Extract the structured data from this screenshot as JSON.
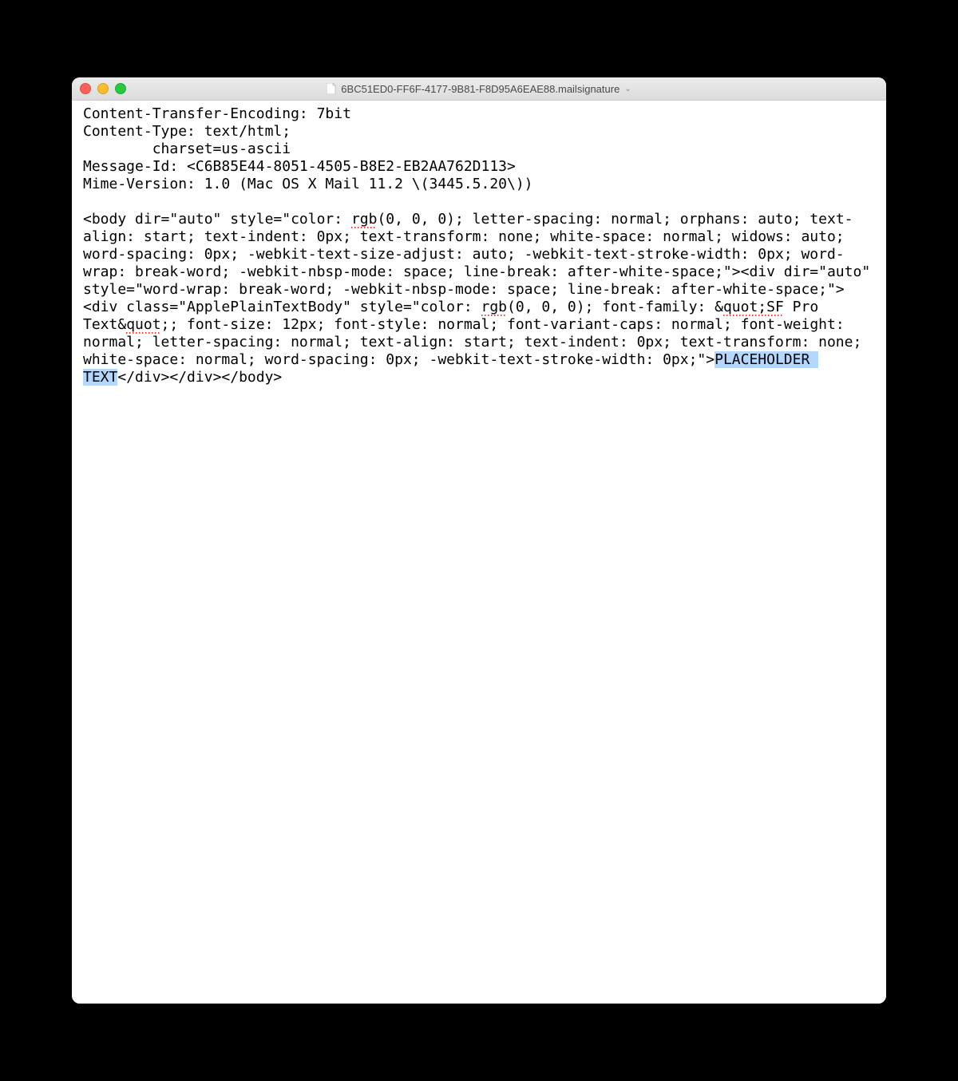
{
  "window": {
    "filename": "6BC51ED0-FF6F-4177-9B81-F8D95A6EAE88.mailsignature"
  },
  "editor": {
    "headers": {
      "l1": "Content-Transfer-Encoding: 7bit",
      "l2": "Content-Type: text/html;",
      "l3": "        charset=us-ascii",
      "l4": "Message-Id: <C6B85E44-8051-4505-B8E2-EB2AA762D113>",
      "l5": "Mime-Version: 1.0 (Mac OS X Mail 11.2 \\(3445.5.20\\))"
    },
    "body": {
      "p1a": "<body dir=\"auto\" style=\"color: ",
      "p1b_sq": "rgb",
      "p1c": "(0, 0, 0); letter-spacing: normal; orphans: auto; text-align: start; text-indent: 0px; text-transform: none; white-space: normal; widows: auto; word-spacing: 0px; -webkit-text-size-adjust: auto; -webkit-text-stroke-width: 0px; word-wrap: break-word; -webkit-nbsp-mode: space; line-break: after-white-space;\"><div dir=\"auto\" style=\"word-wrap: break-word; -webkit-nbsp-mode: space; line-break: after-white-space;\"><div class=\"ApplePlainTextBody\" style=\"color: ",
      "p1d_sq": "rgb",
      "p1e": "(0, 0, 0); font-family: &",
      "p1f_sq": "quot;SF",
      "p1g": " Pro Text&",
      "p1h_sq": "quot",
      "p1i": ";; font-size: 12px; font-style: normal; font-variant-caps: normal; font-weight: normal; letter-spacing: normal; text-align: start; text-indent: 0px; text-transform: none; white-space: normal; word-spacing: 0px; -webkit-text-stroke-width: 0px;\">",
      "p1j_hl": "PLACEHOLDER TEXT",
      "p1k": "</div></div></body>"
    }
  }
}
